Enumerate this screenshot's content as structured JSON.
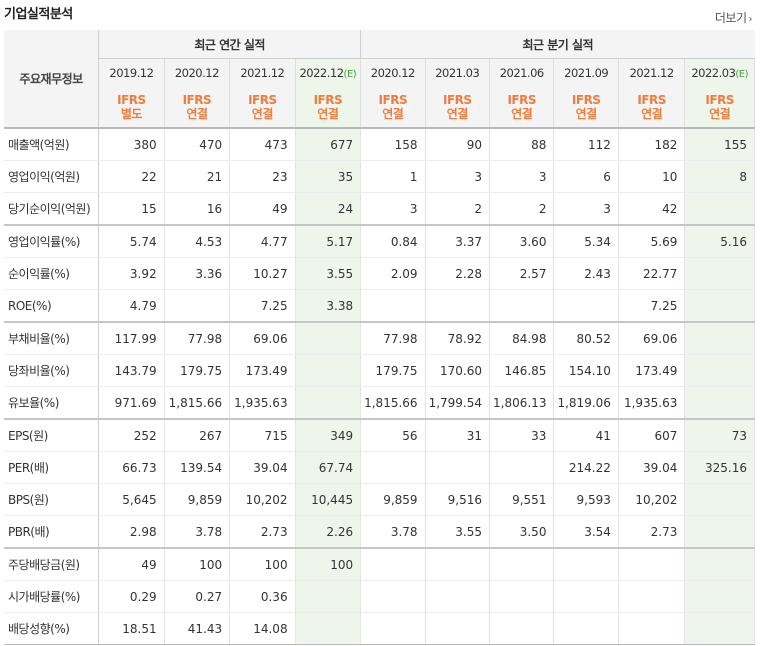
{
  "section_title": "기업실적분석",
  "more_label": "더보기",
  "header": {
    "row_label": "주요재무정보",
    "group_annual": "최근 연간 실적",
    "group_quarter": "최근 분기 실적",
    "periods": [
      {
        "label": "2019.12",
        "est": "",
        "acct1": "IFRS",
        "acct2": "별도"
      },
      {
        "label": "2020.12",
        "est": "",
        "acct1": "IFRS",
        "acct2": "연결"
      },
      {
        "label": "2021.12",
        "est": "",
        "acct1": "IFRS",
        "acct2": "연결"
      },
      {
        "label": "2022.12",
        "est": "(E)",
        "acct1": "IFRS",
        "acct2": "연결"
      },
      {
        "label": "2020.12",
        "est": "",
        "acct1": "IFRS",
        "acct2": "연결"
      },
      {
        "label": "2021.03",
        "est": "",
        "acct1": "IFRS",
        "acct2": "연결"
      },
      {
        "label": "2021.06",
        "est": "",
        "acct1": "IFRS",
        "acct2": "연결"
      },
      {
        "label": "2021.09",
        "est": "",
        "acct1": "IFRS",
        "acct2": "연결"
      },
      {
        "label": "2021.12",
        "est": "",
        "acct1": "IFRS",
        "acct2": "연결"
      },
      {
        "label": "2022.03",
        "est": "(E)",
        "acct1": "IFRS",
        "acct2": "연결"
      }
    ]
  },
  "rows": [
    {
      "label": "매출액(억원)",
      "values": [
        "380",
        "470",
        "473",
        "677",
        "158",
        "90",
        "88",
        "112",
        "182",
        "155"
      ]
    },
    {
      "label": "영업이익(억원)",
      "values": [
        "22",
        "21",
        "23",
        "35",
        "1",
        "3",
        "3",
        "6",
        "10",
        "8"
      ]
    },
    {
      "label": "당기순이익(억원)",
      "values": [
        "15",
        "16",
        "49",
        "24",
        "3",
        "2",
        "2",
        "3",
        "42",
        ""
      ]
    },
    {
      "label": "영업이익률(%)",
      "values": [
        "5.74",
        "4.53",
        "4.77",
        "5.17",
        "0.84",
        "3.37",
        "3.60",
        "5.34",
        "5.69",
        "5.16"
      ]
    },
    {
      "label": "순이익률(%)",
      "values": [
        "3.92",
        "3.36",
        "10.27",
        "3.55",
        "2.09",
        "2.28",
        "2.57",
        "2.43",
        "22.77",
        ""
      ]
    },
    {
      "label": "ROE(%)",
      "values": [
        "4.79",
        "",
        "7.25",
        "3.38",
        "",
        "",
        "",
        "",
        "7.25",
        ""
      ]
    },
    {
      "label": "부채비율(%)",
      "values": [
        "117.99",
        "77.98",
        "69.06",
        "",
        "77.98",
        "78.92",
        "84.98",
        "80.52",
        "69.06",
        ""
      ]
    },
    {
      "label": "당좌비율(%)",
      "values": [
        "143.79",
        "179.75",
        "173.49",
        "",
        "179.75",
        "170.60",
        "146.85",
        "154.10",
        "173.49",
        ""
      ]
    },
    {
      "label": "유보율(%)",
      "values": [
        "971.69",
        "1,815.66",
        "1,935.63",
        "",
        "1,815.66",
        "1,799.54",
        "1,806.13",
        "1,819.06",
        "1,935.63",
        ""
      ]
    },
    {
      "label": "EPS(원)",
      "values": [
        "252",
        "267",
        "715",
        "349",
        "56",
        "31",
        "33",
        "41",
        "607",
        "73"
      ]
    },
    {
      "label": "PER(배)",
      "values": [
        "66.73",
        "139.54",
        "39.04",
        "67.74",
        "",
        "",
        "",
        "214.22",
        "39.04",
        "325.16"
      ]
    },
    {
      "label": "BPS(원)",
      "values": [
        "5,645",
        "9,859",
        "10,202",
        "10,445",
        "9,859",
        "9,516",
        "9,551",
        "9,593",
        "10,202",
        ""
      ]
    },
    {
      "label": "PBR(배)",
      "values": [
        "2.98",
        "3.78",
        "2.73",
        "2.26",
        "3.78",
        "3.55",
        "3.50",
        "3.54",
        "2.73",
        ""
      ]
    },
    {
      "label": "주당배당금(원)",
      "values": [
        "49",
        "100",
        "100",
        "100",
        "",
        "",
        "",
        "",
        "",
        ""
      ]
    },
    {
      "label": "시가배당률(%)",
      "values": [
        "0.29",
        "0.27",
        "0.36",
        "",
        "",
        "",
        "",
        "",
        "",
        ""
      ]
    },
    {
      "label": "배당성향(%)",
      "values": [
        "18.51",
        "41.43",
        "14.08",
        "",
        "",
        "",
        "",
        "",
        "",
        ""
      ]
    }
  ],
  "colors": {
    "accounting_text": "#f07c3e",
    "estimate_bg": "#eef6ec",
    "estimate_mark": "#4f9a4a",
    "header_bg": "#f4f4f4"
  }
}
